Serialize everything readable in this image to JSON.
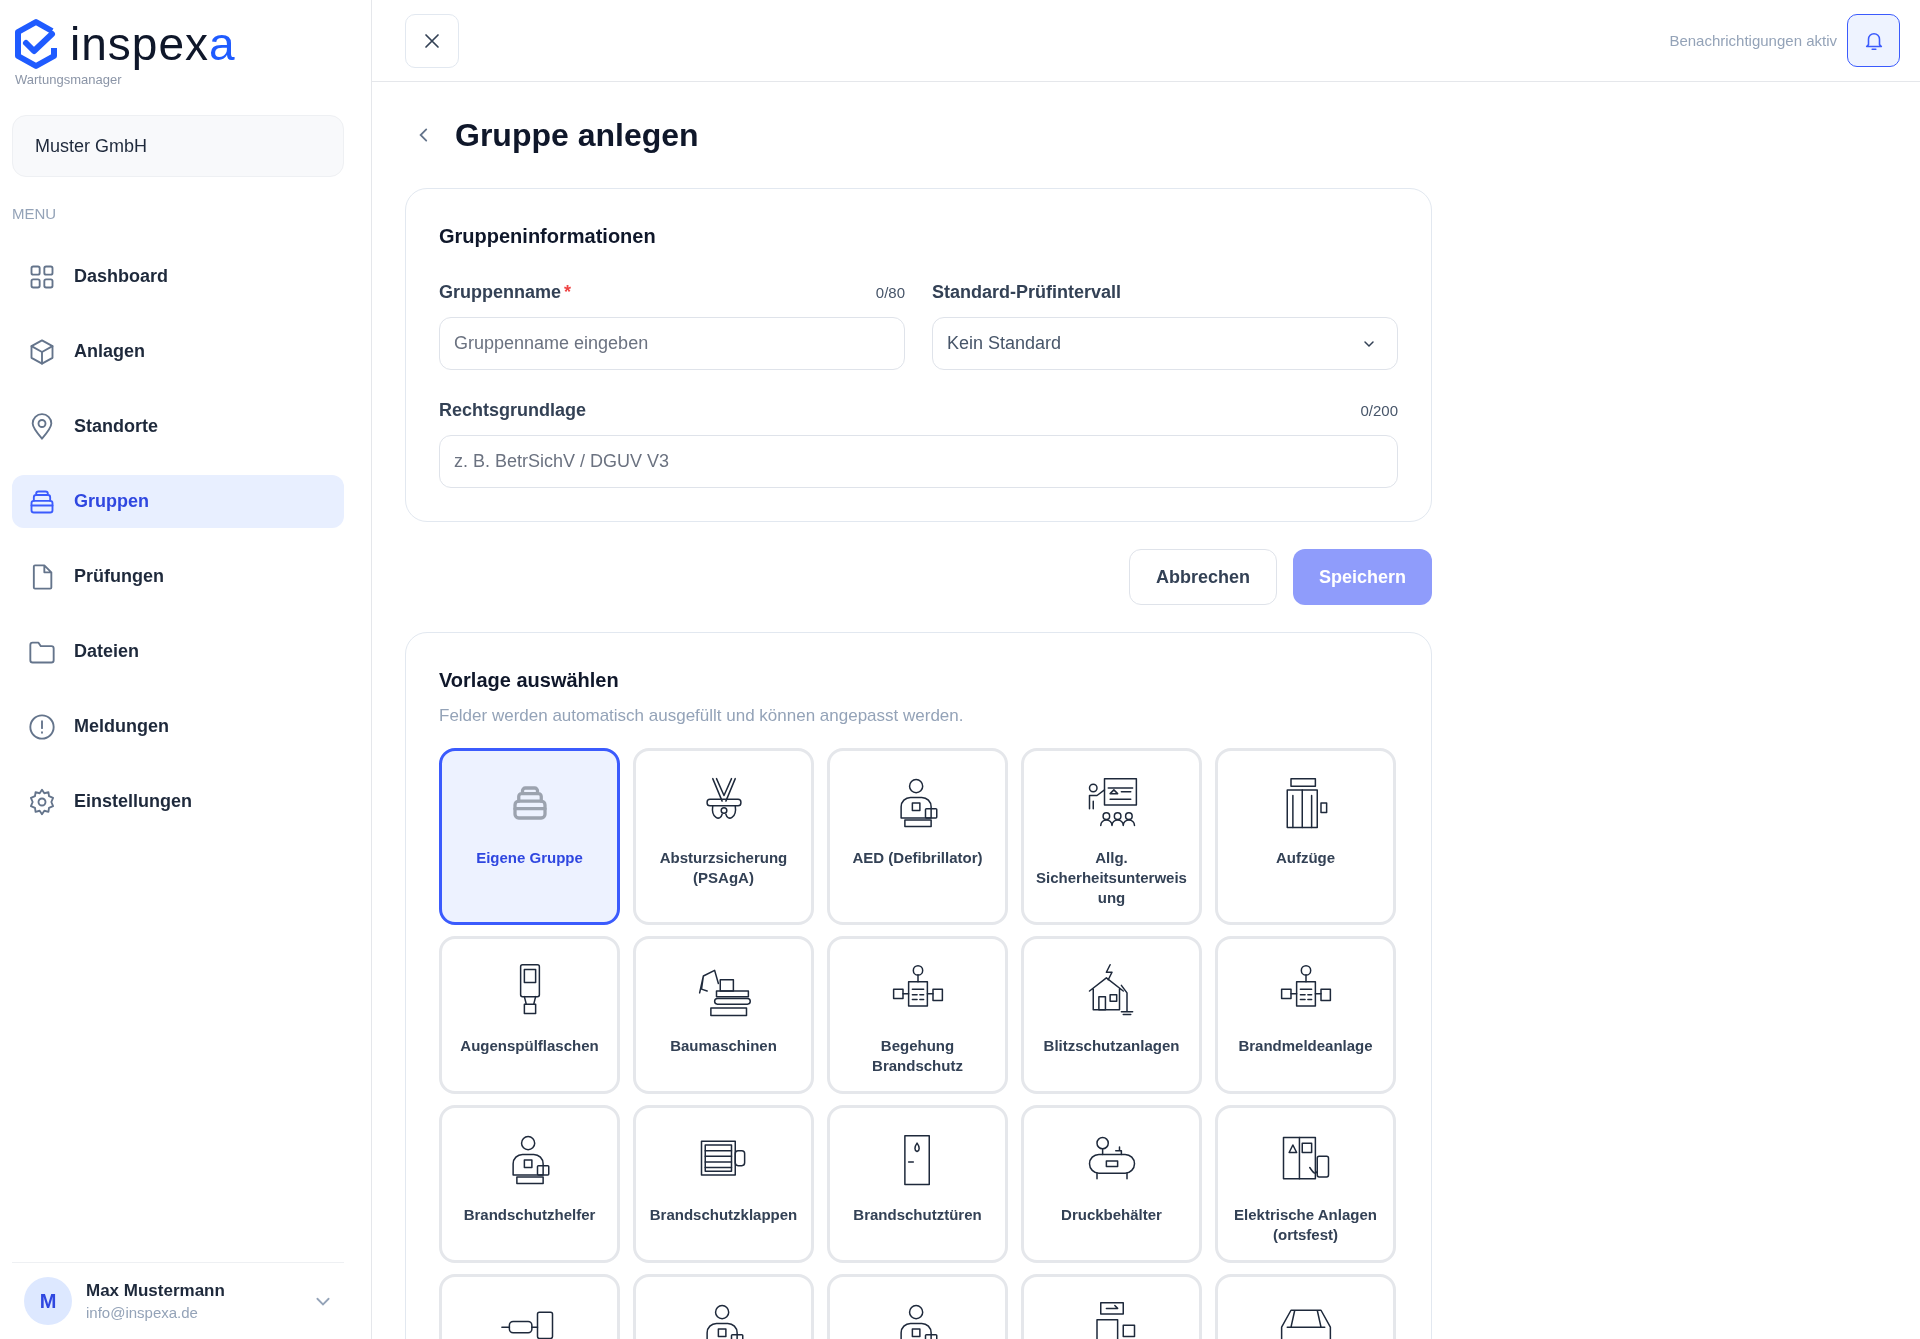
{
  "sidebar": {
    "logo": {
      "name_main": "inspex",
      "name_accent": "a",
      "tagline": "Wartungsmanager"
    },
    "company": "Muster GmbH",
    "menu_heading": "MENU",
    "menu": [
      {
        "label": "Dashboard",
        "selected": false
      },
      {
        "label": "Anlagen",
        "selected": false
      },
      {
        "label": "Standorte",
        "selected": false
      },
      {
        "label": "Gruppen",
        "selected": true
      },
      {
        "label": "Prüfungen",
        "selected": false
      },
      {
        "label": "Dateien",
        "selected": false
      },
      {
        "label": "Meldungen",
        "selected": false
      },
      {
        "label": "Einstellungen",
        "selected": false
      }
    ],
    "user": {
      "initial": "M",
      "name": "Max Mustermann",
      "email": "info@inspexa.de"
    }
  },
  "header": {
    "notifications": "Benachrichtigungen aktiv"
  },
  "page": {
    "title": "Gruppe anlegen"
  },
  "group_info": {
    "title": "Gruppeninformationen",
    "fields": [
      {
        "kind": "text",
        "label": "Gruppenname",
        "required_mark": "*",
        "counter": "0/80",
        "placeholder": "Gruppenname eingeben"
      },
      {
        "kind": "select",
        "label": "Standard-Prüfintervall",
        "value": "Kein Standard"
      },
      {
        "kind": "text",
        "label": "Rechtsgrundlage",
        "counter": "0/200",
        "placeholder": "z. B. BetrSichV / DGUV V3"
      }
    ]
  },
  "actions": {
    "cancel": "Abbrechen",
    "save": "Speichern"
  },
  "templates": {
    "title": "Vorlage auswählen",
    "subtitle": "Felder werden automatisch ausgefüllt und können angepasst werden.",
    "items": [
      {
        "label": "Eigene Gruppe",
        "selected": true
      },
      {
        "label": "Absturzsicherung (PSAgA)",
        "selected": false
      },
      {
        "label": "AED (Defibrillator)",
        "selected": false
      },
      {
        "label": "Allg. Sicherheitsunterweisung",
        "selected": false
      },
      {
        "label": "Aufzüge",
        "selected": false
      },
      {
        "label": "Augenspülflaschen",
        "selected": false
      },
      {
        "label": "Baumaschinen",
        "selected": false
      },
      {
        "label": "Begehung Brandschutz",
        "selected": false
      },
      {
        "label": "Blitzschutzanlagen",
        "selected": false
      },
      {
        "label": "Brandmeldeanlage",
        "selected": false
      },
      {
        "label": "Brandschutzhelfer",
        "selected": false
      },
      {
        "label": "Brandschutzklappen",
        "selected": false
      },
      {
        "label": "Brandschutztüren",
        "selected": false
      },
      {
        "label": "Druckbehälter",
        "selected": false
      },
      {
        "label": "Elektrische Anlagen (ortsfest)",
        "selected": false
      },
      {
        "selected": false
      },
      {
        "selected": false
      },
      {
        "selected": false
      },
      {
        "selected": false
      },
      {
        "selected": false
      }
    ]
  }
}
